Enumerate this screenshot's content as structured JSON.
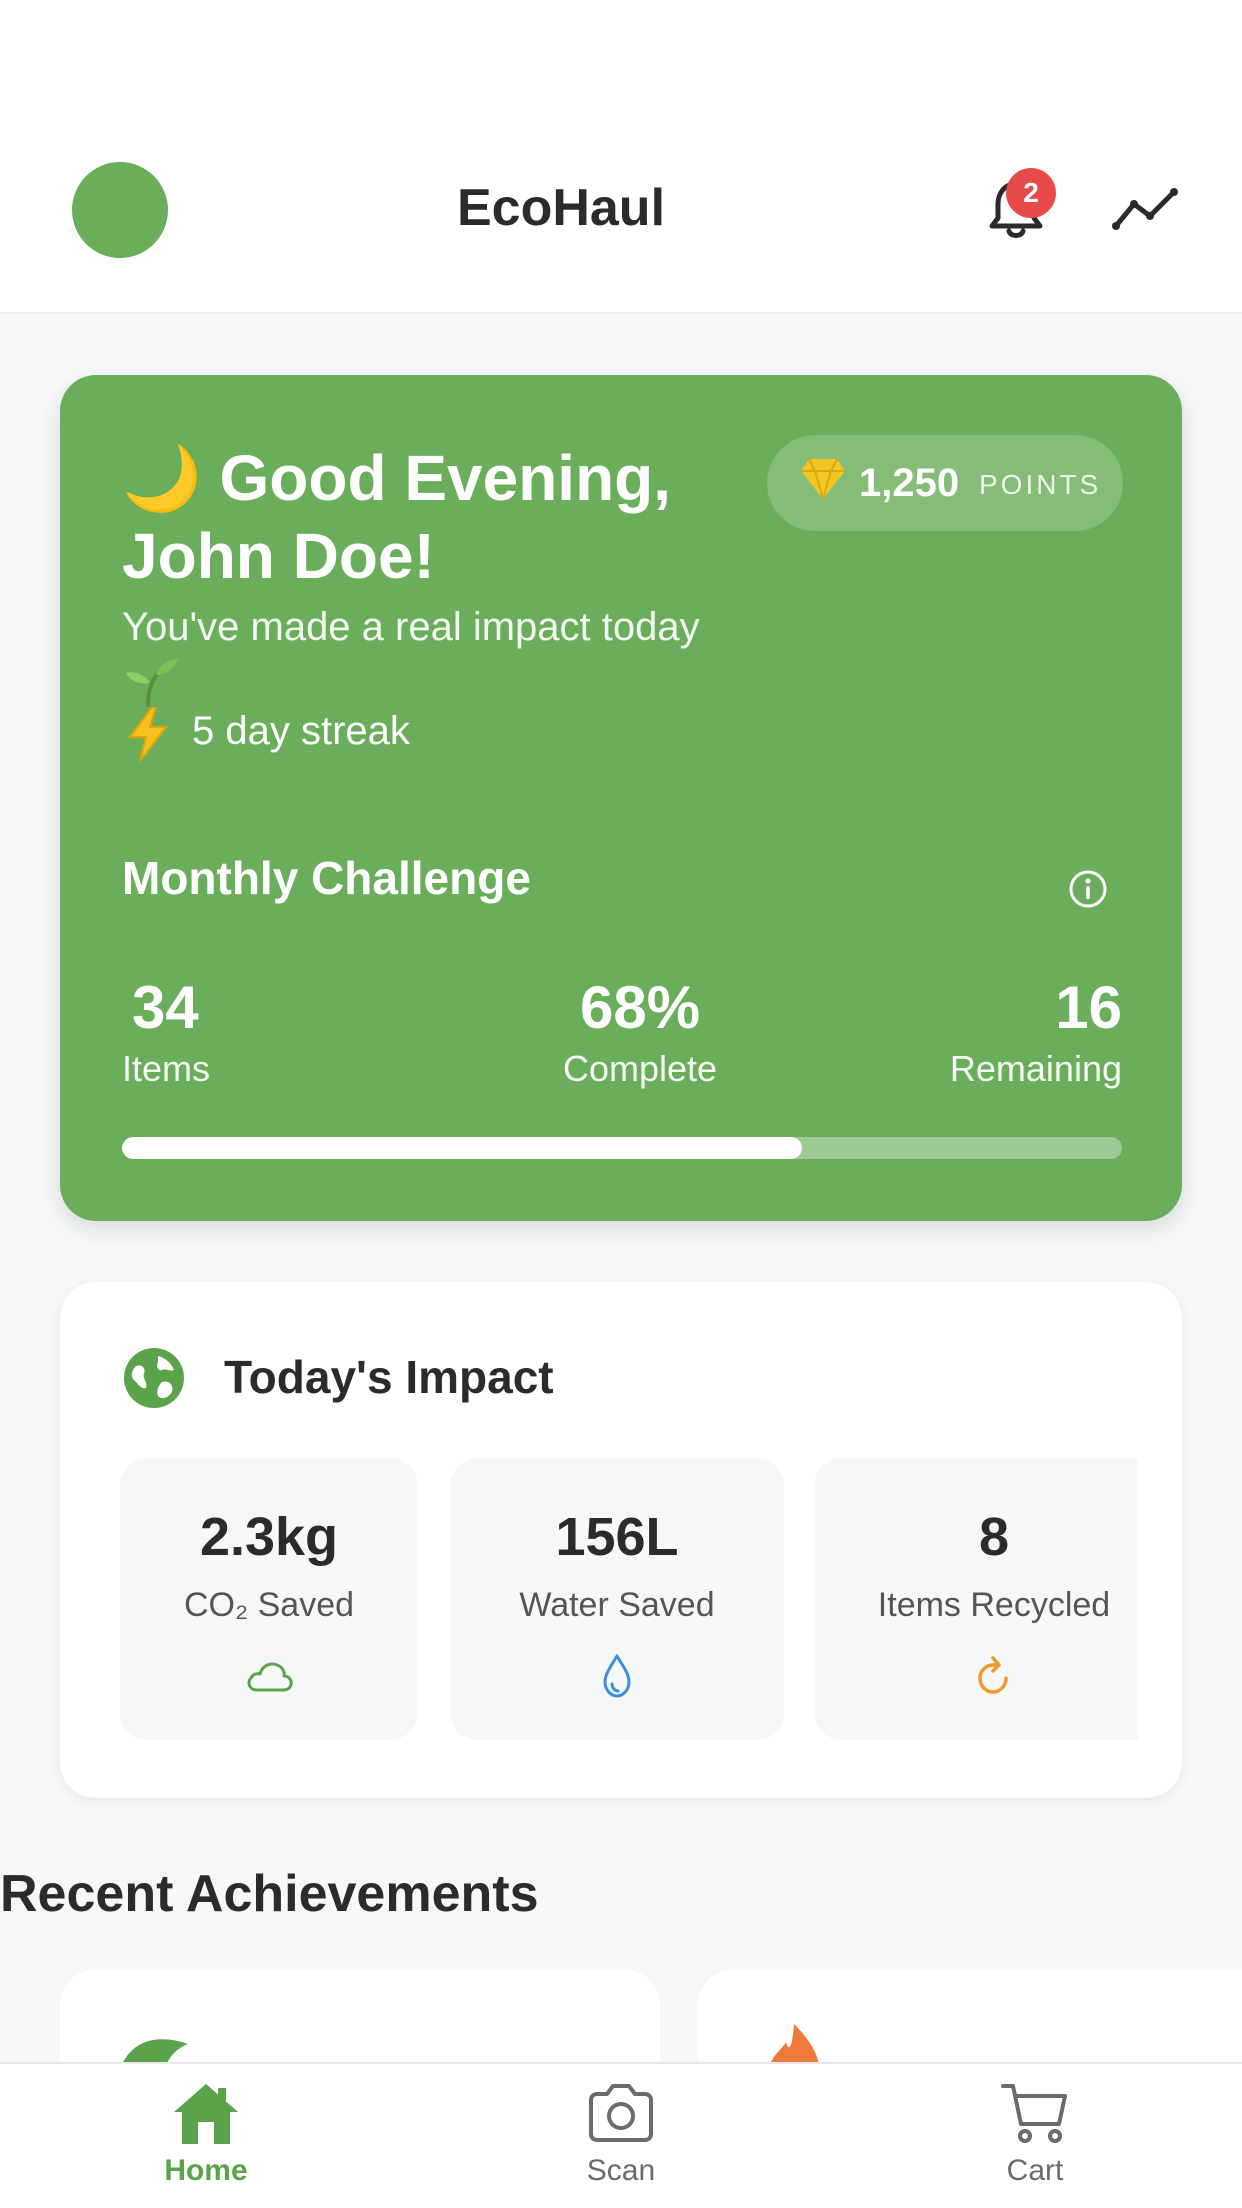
{
  "app": {
    "title": "EcoHaul"
  },
  "notifications": {
    "count": "2"
  },
  "hero": {
    "greeting_emoji": "🌙",
    "greeting": "Good Evening, John Doe!",
    "points_value": "1,250",
    "points_unit": "POINTS",
    "subtitle": "You've made a real impact today",
    "streak": "5 day streak",
    "challenge": {
      "title": "Monthly Challenge",
      "items_value": "34",
      "items_label": "Items",
      "complete_value": "68%",
      "complete_label": "Complete",
      "remaining_value": "16",
      "remaining_label": "Remaining",
      "progress_fraction": 0.68
    },
    "color": "#6aae5b"
  },
  "impact": {
    "title": "Today's Impact",
    "tiles": [
      {
        "value": "2.3kg",
        "label": "CO₂ Saved",
        "icon": "cloud-icon",
        "icon_color": "#5aa34b"
      },
      {
        "value": "156L",
        "label": "Water Saved",
        "icon": "water-drop-icon",
        "icon_color": "#3b8ede"
      },
      {
        "value": "8",
        "label": "Items Recycled",
        "icon": "recycle-refresh-icon",
        "icon_color": "#ef9a2a"
      }
    ]
  },
  "achievements": {
    "title": "Recent Achievements"
  },
  "nav": {
    "items": [
      {
        "label": "Home",
        "icon": "home-icon",
        "active": true
      },
      {
        "label": "Scan",
        "icon": "camera-icon",
        "active": false
      },
      {
        "label": "Cart",
        "icon": "cart-icon",
        "active": false
      }
    ]
  }
}
